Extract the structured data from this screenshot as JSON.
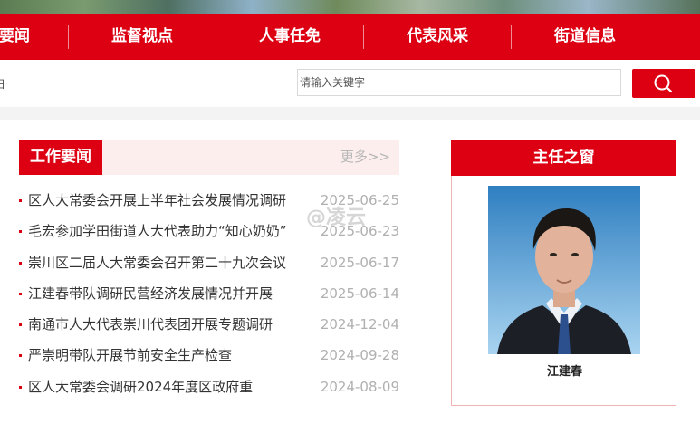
{
  "nav": {
    "items": [
      "要闻",
      "监督视点",
      "人事任免",
      "代表风采",
      "街道信息"
    ]
  },
  "search": {
    "left_stub": "日",
    "placeholder": "请输入关键字",
    "button_icon": "search-icon"
  },
  "news": {
    "section_title": "工作要闻",
    "more_label": "更多>>",
    "items": [
      {
        "title": "区人大常委会开展上半年社会发展情况调研",
        "date": "2025-06-25"
      },
      {
        "title": "毛宏参加学田街道人大代表助力“知心奶奶”",
        "date": "2025-06-23"
      },
      {
        "title": "崇川区二届人大常委会召开第二十九次会议",
        "date": "2025-06-17"
      },
      {
        "title": "江建春带队调研民营经济发展情况并开展",
        "date": "2025-06-14"
      },
      {
        "title": "南通市人大代表崇川代表团开展专题调研",
        "date": "2024-12-04"
      },
      {
        "title": "严崇明带队开展节前安全生产检查",
        "date": "2024-09-28"
      },
      {
        "title": "区人大常委会调研2024年度区政府重",
        "date": "2024-08-09"
      }
    ]
  },
  "director": {
    "section_title": "主任之窗",
    "name": "江建春"
  },
  "watermark": "@凌云",
  "colors": {
    "brand_red": "#dc0012",
    "news_head_bg": "#fdeeee"
  }
}
